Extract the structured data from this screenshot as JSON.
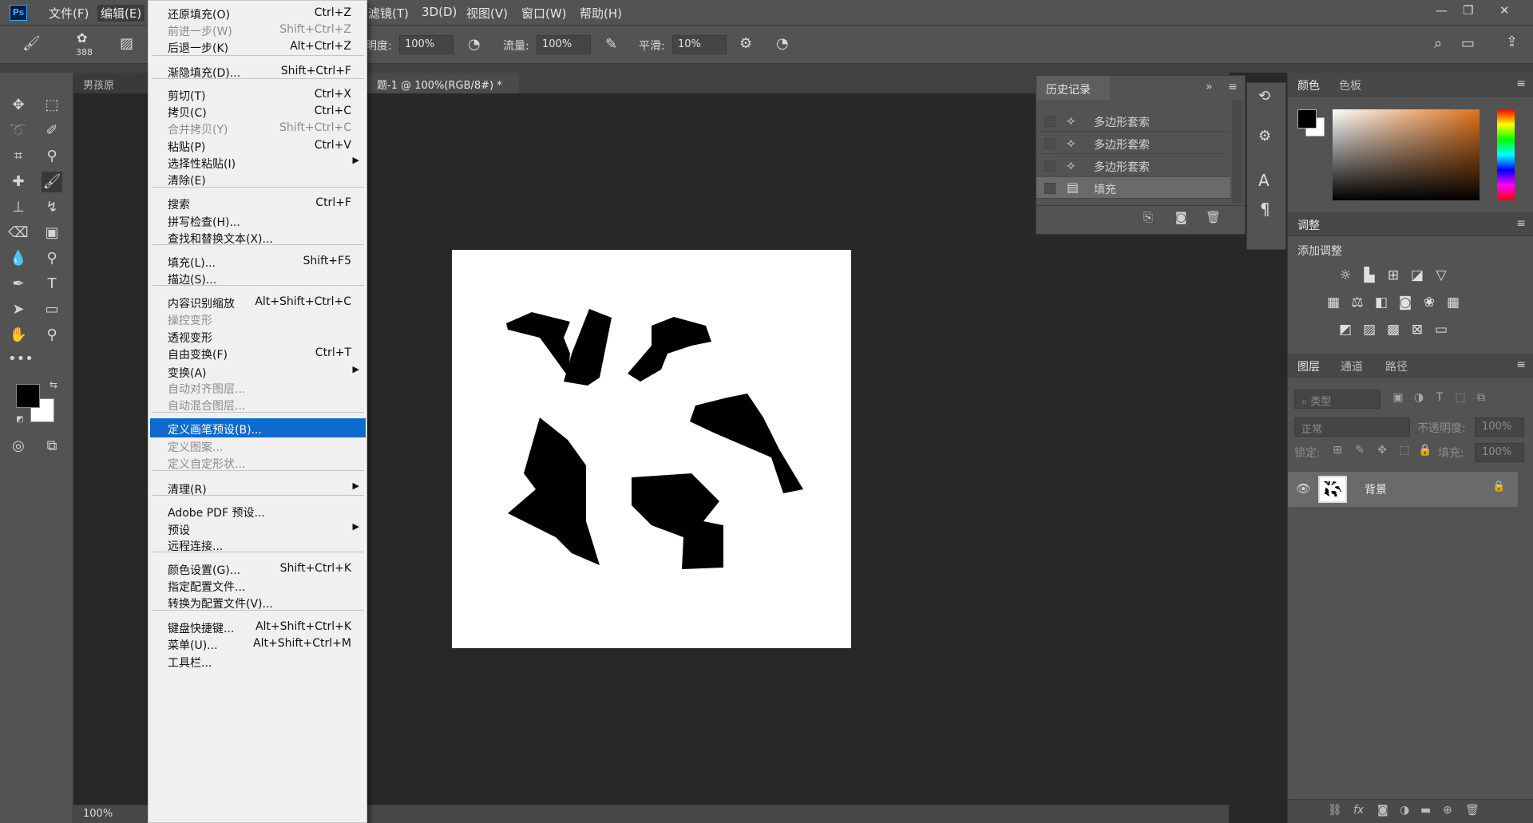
{
  "menubar": {
    "app_icon": "Ps",
    "items": [
      "文件(F)",
      "编辑(E)",
      "滤镜(T)",
      "3D(D)",
      "视图(V)",
      "窗口(W)",
      "帮助(H)"
    ]
  },
  "options": {
    "brush_size": "388",
    "opacity_label": "明度:",
    "opacity_value": "100%",
    "flow_label": "流量:",
    "flow_value": "100%",
    "smooth_label": "平滑:",
    "smooth_value": "10%"
  },
  "tabs": {
    "doc1": "男孩原图.ps",
    "doc2": "题-1 @ 100%(RGB/8#) *",
    "close": "×"
  },
  "status": {
    "zoom": "100%"
  },
  "edit_menu": [
    {
      "label": "还原填充(O)",
      "shortcut": "Ctrl+Z",
      "disabled": false
    },
    {
      "label": "前进一步(W)",
      "shortcut": "Shift+Ctrl+Z",
      "disabled": true
    },
    {
      "label": "后退一步(K)",
      "shortcut": "Alt+Ctrl+Z",
      "disabled": false
    },
    {
      "label": "渐隐填充(D)...",
      "shortcut": "Shift+Ctrl+F",
      "disabled": false
    },
    {
      "label": "剪切(T)",
      "shortcut": "Ctrl+X",
      "disabled": false
    },
    {
      "label": "拷贝(C)",
      "shortcut": "Ctrl+C",
      "disabled": false
    },
    {
      "label": "合并拷贝(Y)",
      "shortcut": "Shift+Ctrl+C",
      "disabled": true
    },
    {
      "label": "粘贴(P)",
      "shortcut": "Ctrl+V",
      "disabled": false
    },
    {
      "label": "选择性粘贴(I)",
      "shortcut": "",
      "disabled": false,
      "submenu": true
    },
    {
      "label": "清除(E)",
      "shortcut": "",
      "disabled": false
    },
    {
      "label": "搜索",
      "shortcut": "Ctrl+F",
      "disabled": false
    },
    {
      "label": "拼写检查(H)...",
      "shortcut": "",
      "disabled": false
    },
    {
      "label": "查找和替换文本(X)...",
      "shortcut": "",
      "disabled": false
    },
    {
      "label": "填充(L)...",
      "shortcut": "Shift+F5",
      "disabled": false
    },
    {
      "label": "描边(S)...",
      "shortcut": "",
      "disabled": false
    },
    {
      "label": "内容识别缩放",
      "shortcut": "Alt+Shift+Ctrl+C",
      "disabled": false
    },
    {
      "label": "操控变形",
      "shortcut": "",
      "disabled": true
    },
    {
      "label": "透视变形",
      "shortcut": "",
      "disabled": false
    },
    {
      "label": "自由变换(F)",
      "shortcut": "Ctrl+T",
      "disabled": false
    },
    {
      "label": "变换(A)",
      "shortcut": "",
      "disabled": false,
      "submenu": true
    },
    {
      "label": "自动对齐图层...",
      "shortcut": "",
      "disabled": true
    },
    {
      "label": "自动混合图层...",
      "shortcut": "",
      "disabled": true
    },
    {
      "label": "定义画笔预设(B)...",
      "shortcut": "",
      "disabled": false,
      "highlighted": true
    },
    {
      "label": "定义图案...",
      "shortcut": "",
      "disabled": true
    },
    {
      "label": "定义自定形状...",
      "shortcut": "",
      "disabled": true
    },
    {
      "label": "清理(R)",
      "shortcut": "",
      "disabled": false,
      "submenu": true
    },
    {
      "label": "Adobe PDF 预设...",
      "shortcut": "",
      "disabled": false
    },
    {
      "label": "预设",
      "shortcut": "",
      "disabled": false,
      "submenu": true
    },
    {
      "label": "远程连接...",
      "shortcut": "",
      "disabled": false
    },
    {
      "label": "颜色设置(G)...",
      "shortcut": "Shift+Ctrl+K",
      "disabled": false
    },
    {
      "label": "指定配置文件...",
      "shortcut": "",
      "disabled": false
    },
    {
      "label": "转换为配置文件(V)...",
      "shortcut": "",
      "disabled": false
    },
    {
      "label": "键盘快捷键...",
      "shortcut": "Alt+Shift+Ctrl+K",
      "disabled": false
    },
    {
      "label": "菜单(U)...",
      "shortcut": "Alt+Shift+Ctrl+M",
      "disabled": false
    },
    {
      "label": "工具栏...",
      "shortcut": "",
      "disabled": false
    }
  ],
  "history": {
    "title": "历史记录",
    "items": [
      "多边形套索",
      "多边形套索",
      "多边形套索",
      "填充"
    ]
  },
  "right": {
    "color_tab": "颜色",
    "swatch_tab": "色板",
    "adjust_title": "调整",
    "add_adjust": "添加调整",
    "layers_tab": "图层",
    "channels_tab": "通道",
    "paths_tab": "路径",
    "filter_placeholder": "类型",
    "blend_mode": "正常",
    "opacity_label": "不透明度:",
    "opacity_value": "100%",
    "lock_label": "锁定:",
    "fill_label": "填充:",
    "fill_value": "100%",
    "layer_name": "背景"
  },
  "colors": {
    "foreground": "#000000",
    "background": "#ffffff",
    "highlight": "#0f6ad0"
  }
}
